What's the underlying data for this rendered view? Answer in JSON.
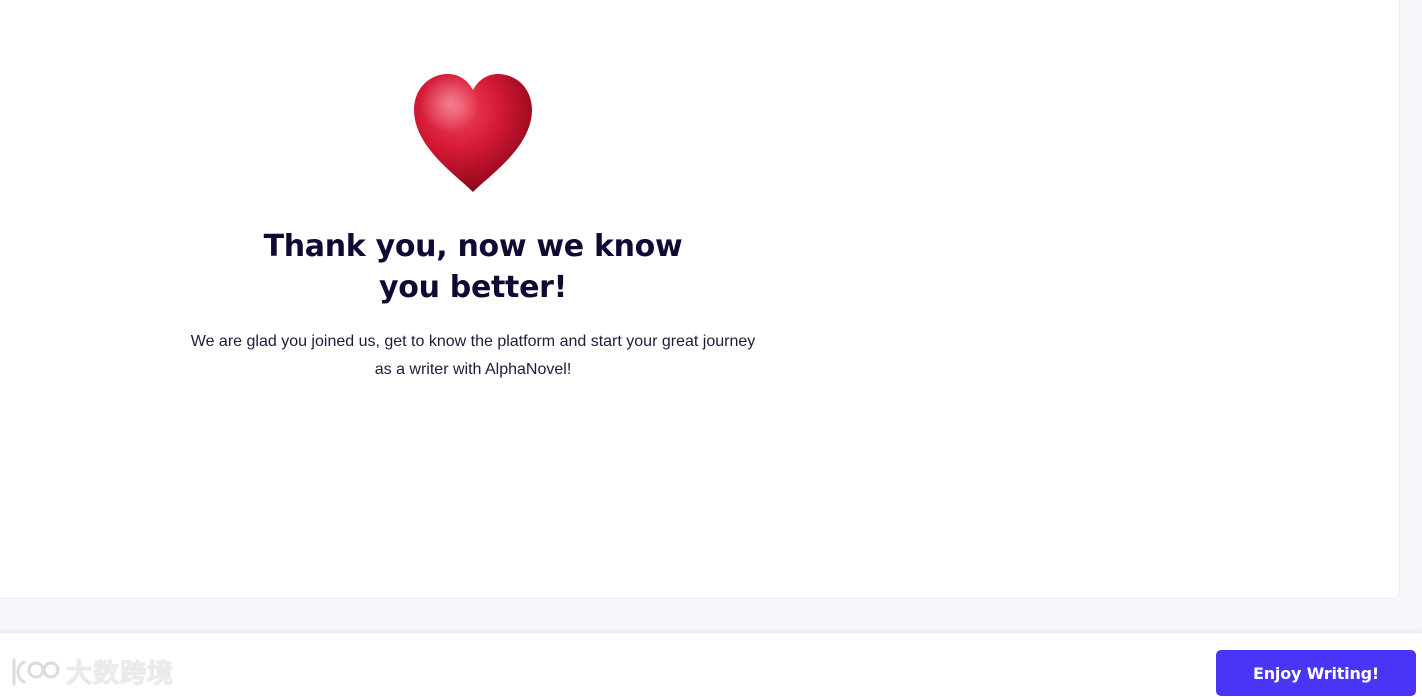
{
  "success": {
    "title": "Thank you, now we know you better!",
    "message": "We are glad you joined us, get to know the platform and start your great journey as a writer with AlphaNovel!",
    "icon": "heart-icon"
  },
  "footer": {
    "watermark": "大数跨境",
    "cta_label": "Enjoy Writing!"
  },
  "colors": {
    "accent": "#4a34f5",
    "heading": "#0e0a33",
    "heart": "#c8102e"
  }
}
